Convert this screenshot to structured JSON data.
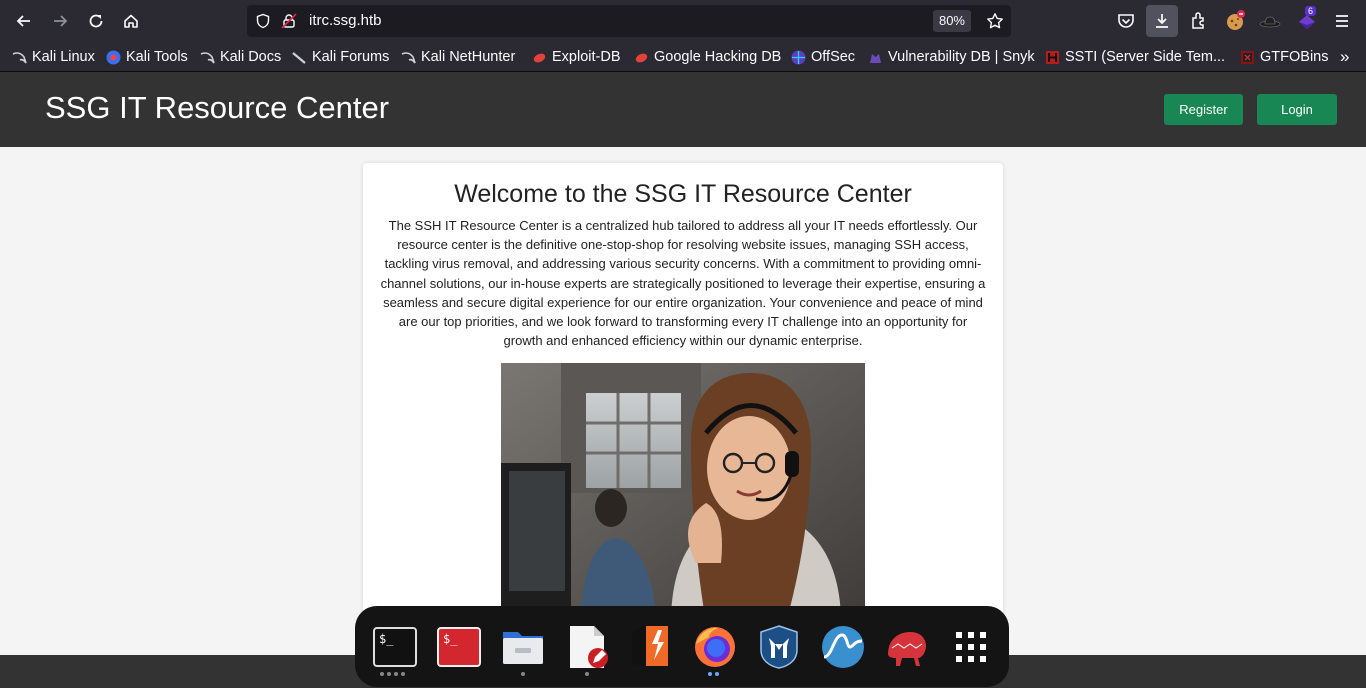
{
  "browser": {
    "url": "itrc.ssg.htb",
    "zoom": "80%",
    "extension_badge": "6",
    "bookmarks": [
      "Kali Linux",
      "Kali Tools",
      "Kali Docs",
      "Kali Forums",
      "Kali NetHunter",
      "Exploit-DB",
      "Google Hacking DB",
      "OffSec",
      "Vulnerability DB | Snyk",
      "SSTI (Server Side Tem...",
      "GTFOBins"
    ],
    "more": "»"
  },
  "header": {
    "title": "SSG IT Resource Center",
    "register_label": "Register",
    "login_label": "Login"
  },
  "main": {
    "heading": "Welcome to the SSG IT Resource Center",
    "intro": "The SSH IT Resource Center is a centralized hub tailored to address all your IT needs effortlessly. Our resource center is the definitive one-stop-shop for resolving website issues, managing SSH access, tackling virus removal, and addressing various security concerns. With a commitment to providing omni-channel solutions, our in-house experts are strategically positioned to leverage their expertise, ensuring a seamless and secure digital experience for our entire organization. Your convenience and peace of mind are our top priorities, and we look forward to transforming every IT challenge into an opportunity for growth and enhanced efficiency within our dynamic enterprise."
  },
  "dock": {
    "items": [
      "terminal-icon",
      "root-terminal-icon",
      "files-icon",
      "text-editor-icon",
      "burp-suite-icon",
      "firefox-icon",
      "metasploit-icon",
      "wireshark-icon",
      "maltego-icon",
      "app-grid-icon"
    ]
  },
  "colors": {
    "chrome": "#2b2a33",
    "header": "#333333",
    "button": "#198754"
  }
}
